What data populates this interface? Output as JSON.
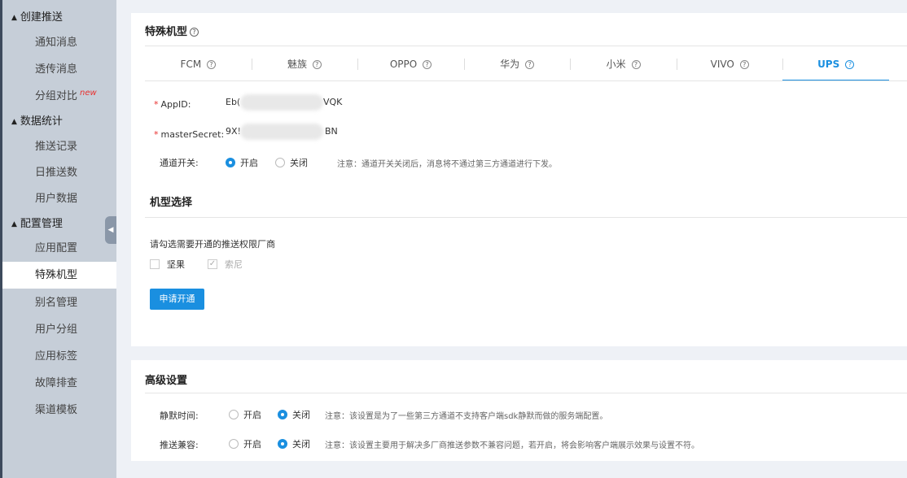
{
  "sidebar": {
    "groups": [
      {
        "label": "创建推送",
        "items": [
          {
            "label": "通知消息"
          },
          {
            "label": "透传消息"
          },
          {
            "label": "分组对比",
            "badge": "new"
          }
        ]
      },
      {
        "label": "数据统计",
        "items": [
          {
            "label": "推送记录"
          },
          {
            "label": "日推送数"
          },
          {
            "label": "用户数据"
          }
        ]
      },
      {
        "label": "配置管理",
        "items": [
          {
            "label": "应用配置"
          },
          {
            "label": "特殊机型"
          },
          {
            "label": "别名管理"
          },
          {
            "label": "用户分组"
          },
          {
            "label": "应用标签"
          },
          {
            "label": "故障排查"
          },
          {
            "label": "渠道模板"
          }
        ]
      }
    ],
    "active": "特殊机型"
  },
  "special_models": {
    "title": "特殊机型",
    "tabs": [
      {
        "label": "FCM"
      },
      {
        "label": "魅族"
      },
      {
        "label": "OPPO"
      },
      {
        "label": "华为"
      },
      {
        "label": "小米"
      },
      {
        "label": "VIVO"
      },
      {
        "label": "UPS"
      }
    ],
    "active_tab": "UPS",
    "form": {
      "appid_label": "AppID:",
      "appid_value_start": "Eb(",
      "appid_value_end": "VQK",
      "secret_label": "masterSecret:",
      "secret_value_start": "9X!",
      "secret_value_end": "BN",
      "channel_label": "通道开关:",
      "channel_on": "开启",
      "channel_off": "关闭",
      "channel_selected": "开启",
      "channel_note": "注意：通道开关关闭后，消息将不通过第三方通道进行下发。"
    },
    "model_select": {
      "title": "机型选择",
      "hint": "请勾选需要开通的推送权限厂商",
      "options": [
        {
          "label": "坚果",
          "checked": false
        },
        {
          "label": "索尼",
          "checked": true,
          "disabled": true
        }
      ],
      "apply_label": "申请开通"
    }
  },
  "advanced": {
    "title": "高级设置",
    "rows": [
      {
        "label": "静默时间:",
        "on": "开启",
        "off": "关闭",
        "selected": "关闭",
        "note": "注意：该设置是为了一些第三方通道不支持客户端sdk静默而做的服务端配置。"
      },
      {
        "label": "推送兼容:",
        "on": "开启",
        "off": "关闭",
        "selected": "关闭",
        "note": "注意：该设置主要用于解决多厂商推送参数不兼容问题，若开启，将会影响客户端展示效果与设置不符。"
      }
    ]
  },
  "colors": {
    "accent": "#1a8fe0",
    "sidebar_bg": "#c6ced8",
    "required": "#e8312f"
  }
}
